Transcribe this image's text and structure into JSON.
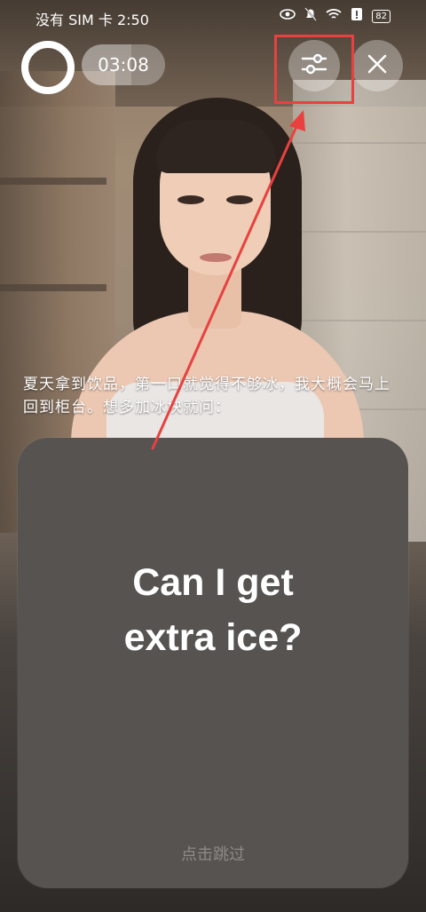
{
  "status_bar": {
    "carrier_time": "没有 SIM 卡 2:50",
    "battery": "82"
  },
  "controls": {
    "timer": "03:08",
    "timer_progress": 0.6,
    "settings_icon": "sliders-icon",
    "close_icon": "close-icon"
  },
  "prompt": {
    "text": "夏天拿到饮品，第一口就觉得不够冰，我大概会马上回到柜台。想多加冰块就问："
  },
  "card": {
    "line1": "Can I get",
    "line2": "extra ice?",
    "skip_label": "点击跳过"
  },
  "colors": {
    "highlight": "#e8413f",
    "card_bg": "#565351"
  }
}
